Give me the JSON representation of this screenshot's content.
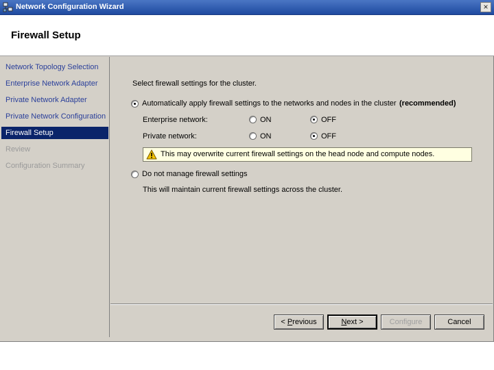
{
  "window": {
    "title": "Network Configuration Wizard",
    "close_label": "×"
  },
  "header": {
    "title": "Firewall Setup"
  },
  "sidebar": {
    "items": [
      {
        "label": "Network Topology Selection",
        "state": "link"
      },
      {
        "label": "Enterprise Network Adapter",
        "state": "link"
      },
      {
        "label": "Private Network Adapter",
        "state": "link"
      },
      {
        "label": "Private Network Configuration",
        "state": "link"
      },
      {
        "label": "Firewall Setup",
        "state": "active"
      },
      {
        "label": "Review",
        "state": "disabled"
      },
      {
        "label": "Configuration Summary",
        "state": "disabled"
      }
    ]
  },
  "main": {
    "prompt": "Select firewall settings for the cluster.",
    "auto_option": {
      "label": "Automatically apply firewall settings to the networks and nodes in the cluster",
      "suffix": "(recommended)",
      "selected": true
    },
    "enterprise": {
      "label": "Enterprise network:",
      "on": "ON",
      "off": "OFF",
      "selected": "OFF"
    },
    "private": {
      "label": "Private network:",
      "on": "ON",
      "off": "OFF",
      "selected": "OFF"
    },
    "warning": {
      "text": "This may overwrite current firewall settings on the head node and compute nodes."
    },
    "manual_option": {
      "label": "Do not manage firewall settings",
      "selected": false,
      "description": "This will maintain current firewall settings across the cluster."
    }
  },
  "buttons": {
    "previous_pre": "< ",
    "previous_mnemonic": "P",
    "previous_rest": "revious",
    "next_mnemonic": "N",
    "next_rest": "ext >",
    "configure": "Configure",
    "cancel": "Cancel"
  },
  "colors": {
    "titlebar": "#1f4aa0",
    "active_nav": "#0a246a",
    "link_text": "#2a3f9a",
    "warning_bg": "#ffffe1"
  },
  "icons": {
    "app": "network-app-icon",
    "warning": "warning-triangle-icon"
  }
}
